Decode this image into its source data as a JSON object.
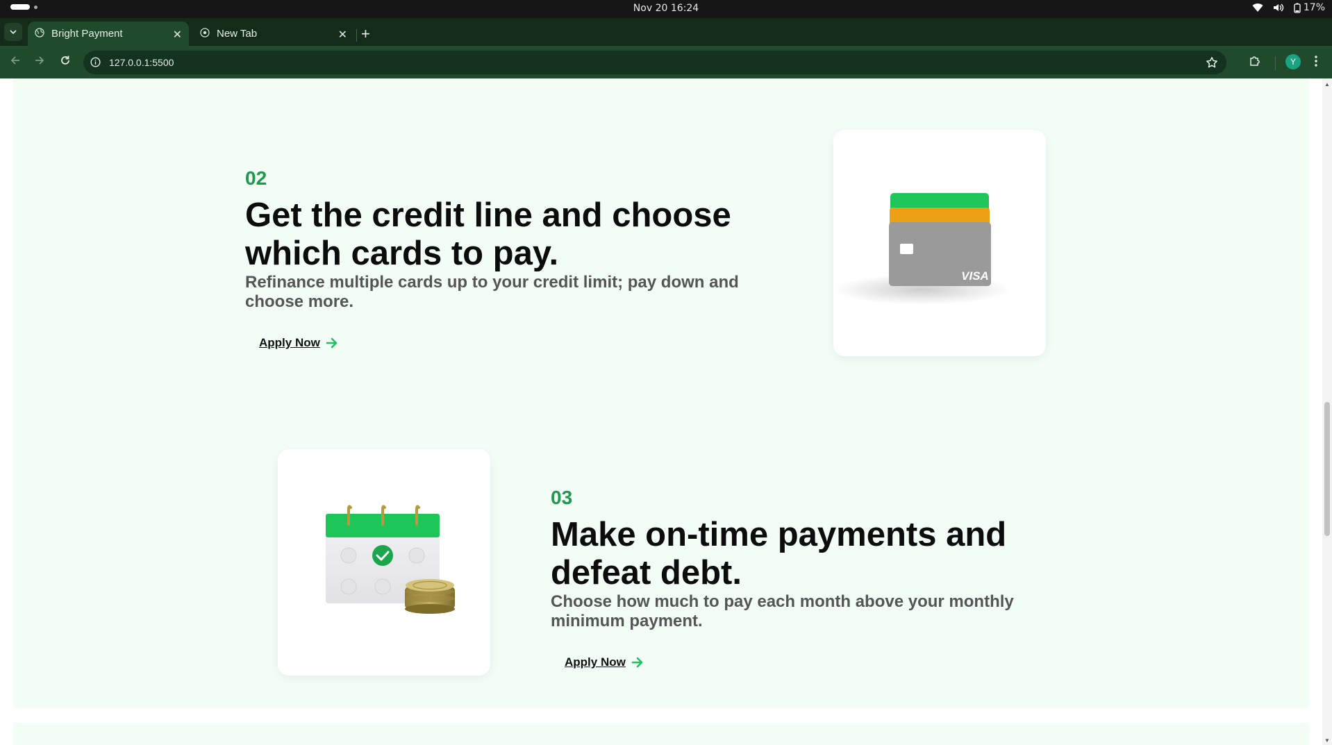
{
  "os": {
    "clock": "Nov 20  16:24",
    "battery": "17%"
  },
  "browser": {
    "tabs": [
      {
        "title": "Bright Payment",
        "icon": "globe-icon",
        "active": true
      },
      {
        "title": "New Tab",
        "icon": "chrome-icon",
        "active": false
      }
    ],
    "url": "127.0.0.1:5500",
    "profile_initial": "Y"
  },
  "steps": [
    {
      "number": "02",
      "title": "Get the credit line and choose which cards to pay.",
      "description": "Refinance multiple cards up to your credit limit; pay down and choose more.",
      "cta": "Apply Now",
      "illustration": "credit-cards-illustration",
      "card_label": "VISA"
    },
    {
      "number": "03",
      "title": "Make on-time payments and defeat debt.",
      "description": "Choose how much to pay each month above your monthly minimum payment.",
      "cta": "Apply Now",
      "illustration": "calendar-coins-illustration"
    }
  ],
  "colors": {
    "accent": "#1e9a4c",
    "arrow": "#1fc164",
    "section_bg": "#f1fdf5",
    "card_green": "#1ec65a",
    "card_orange": "#eaa012",
    "card_gray": "#9a9a9a",
    "browser_frame": "#204a2c"
  }
}
